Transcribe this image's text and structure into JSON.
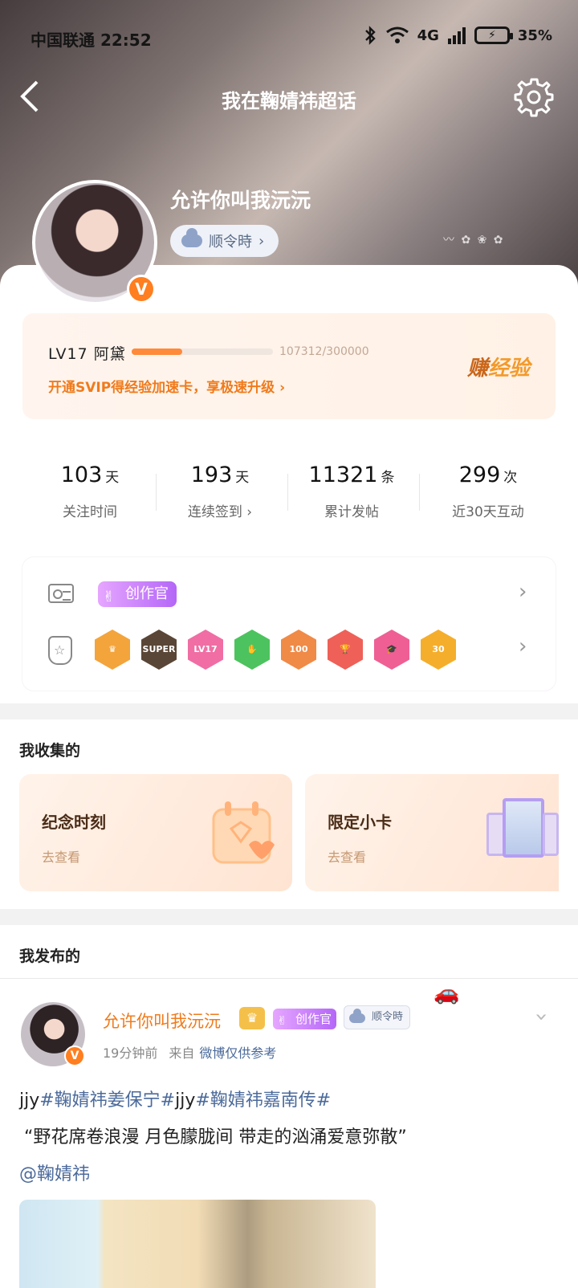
{
  "status_bar": {
    "carrier_time": "中国联通 22:52",
    "network": "4G",
    "battery": "35%"
  },
  "header": {
    "title": "我在鞠婧祎超话"
  },
  "profile": {
    "username": "允许你叫我沅沅",
    "rank": "顺令時",
    "verified_badge": "V",
    "hero_deco": "〰 ✿ ❀ ✿"
  },
  "level": {
    "label": "LV17  阿黛",
    "progress_text": "107312/300000",
    "progress": 0.358,
    "promo": "开通SVIP得经验加速卡，享极速升级",
    "earn_a": "赚",
    "earn_b": "经验"
  },
  "stats": [
    {
      "num": "103",
      "unit": "天",
      "label": "关注时间"
    },
    {
      "num": "193",
      "unit": "天",
      "label": "连续签到"
    },
    {
      "num": "11321",
      "unit": "条",
      "label": "累计发帖"
    },
    {
      "num": "299",
      "unit": "次",
      "label": "近30天互动"
    }
  ],
  "badges": {
    "creator": "创作官",
    "medals": [
      {
        "label": "♛",
        "color": "#f3a43b"
      },
      {
        "label": "SUPER",
        "color": "#5a4636"
      },
      {
        "label": "LV17",
        "color": "#f06ea4"
      },
      {
        "label": "✋",
        "color": "#4cc35e"
      },
      {
        "label": "100",
        "color": "#f08a47"
      },
      {
        "label": "🏆",
        "color": "#ef6058"
      },
      {
        "label": "🎓",
        "color": "#ef5f93"
      },
      {
        "label": "30",
        "color": "#f5ae2b"
      }
    ]
  },
  "collection": {
    "title": "我收集的",
    "items": [
      {
        "title": "纪念时刻",
        "sub": "去查看"
      },
      {
        "title": "限定小卡",
        "sub": "去查看"
      }
    ]
  },
  "posted": {
    "title": "我发布的"
  },
  "post": {
    "author": "允许你叫我沅沅",
    "crown": "♛",
    "creator": "创作官",
    "rank": "顺令時",
    "verified": "V",
    "time": "19分钟前",
    "from_label": "来自",
    "from": "微博仅供参考",
    "deco": "🚗",
    "tags_line": [
      "jjy",
      "#鞠婧祎姜保宁#",
      "jjy",
      "#鞠婧祎嘉南传#"
    ],
    "quote": "“野花席卷浪漫  月色朦胧间  带走的汹涌爱意弥散”",
    "mention": "@鞠婧祎"
  }
}
